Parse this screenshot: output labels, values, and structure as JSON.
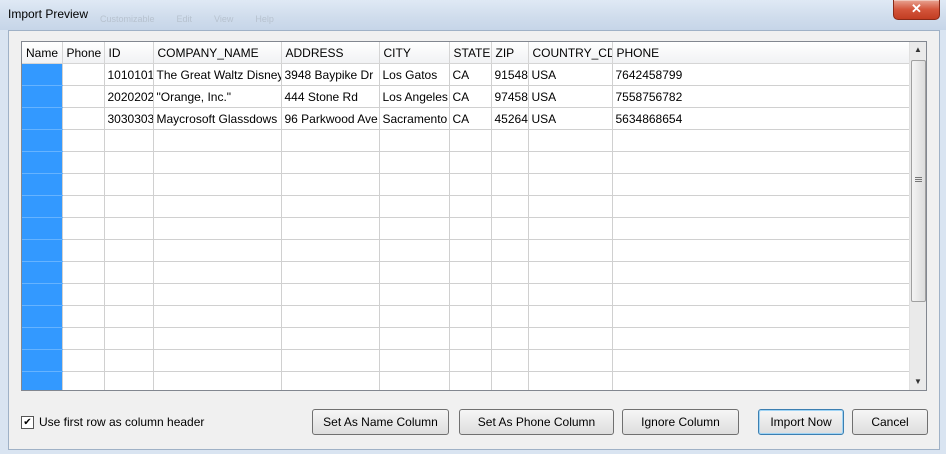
{
  "window": {
    "title": "Import Preview",
    "ghost_menu": [
      "Customizable",
      "Edit",
      "View",
      "Help"
    ],
    "close_glyph": "✕"
  },
  "grid": {
    "columns": [
      "Name",
      "Phone",
      "ID",
      "COMPANY_NAME",
      "ADDRESS",
      "CITY",
      "STATE",
      "ZIP",
      "COUNTRY_CD",
      "PHONE"
    ],
    "rows": [
      [
        "",
        "",
        "1010101",
        "The Great Waltz Disney",
        "3948 Baypike Dr",
        "Los Gatos",
        "CA",
        "91548",
        "USA",
        "7642458799"
      ],
      [
        "",
        "",
        "2020202",
        "\"Orange, Inc.\"",
        "444 Stone Rd",
        "Los Angeles",
        "CA",
        "97458",
        "USA",
        "7558756782"
      ],
      [
        "",
        "",
        "3030303",
        "Maycrosoft Glassdows",
        "96 Parkwood Ave",
        "Sacramento",
        "CA",
        "45264",
        "USA",
        "5634868654"
      ]
    ],
    "total_visible_rows": 15,
    "selected_column": "Name",
    "selection_color": "#3399ff"
  },
  "scrollbar": {
    "up_glyph": "▲",
    "down_glyph": "▼"
  },
  "options": {
    "first_row_header_label": "Use first row as column header",
    "first_row_header_checked": true,
    "check_glyph": "✔"
  },
  "buttons": {
    "set_name": "Set As Name Column",
    "set_phone": "Set As Phone Column",
    "ignore": "Ignore Column",
    "import": "Import Now",
    "cancel": "Cancel"
  }
}
